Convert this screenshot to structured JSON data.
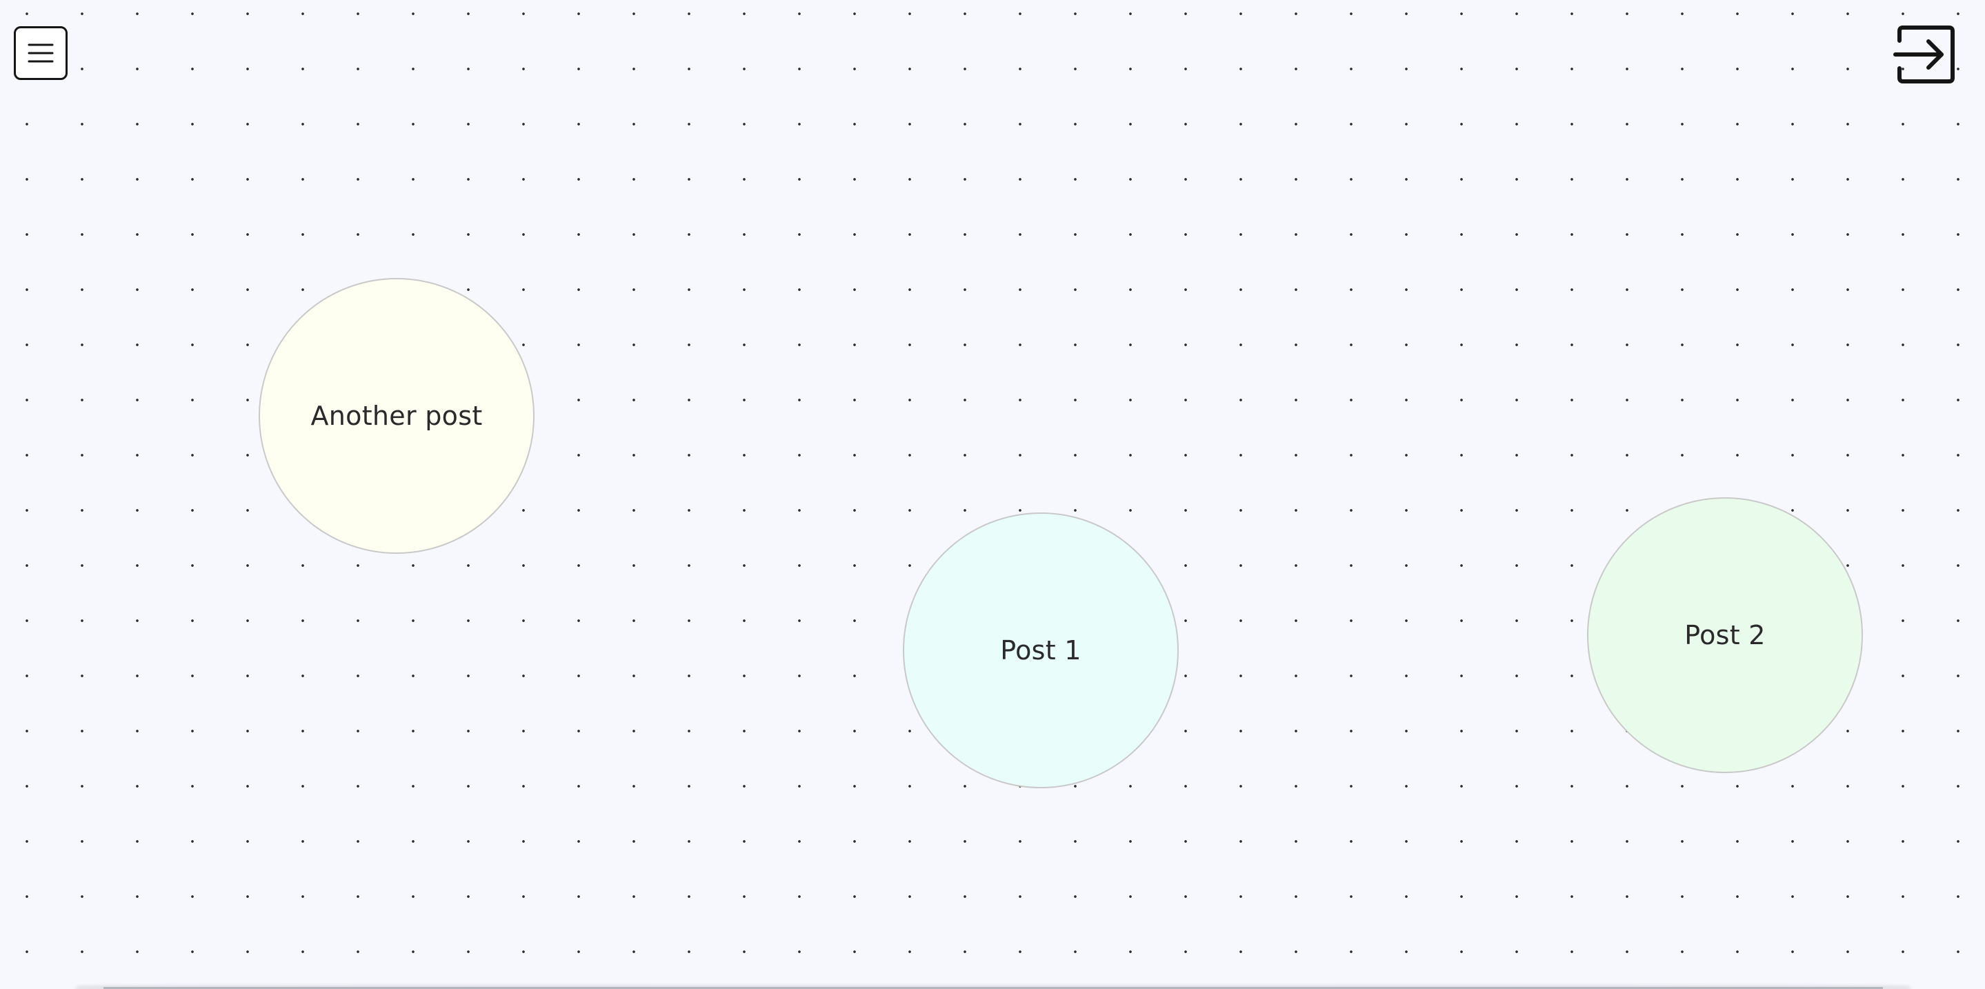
{
  "toolbar": {
    "menu_icon": "menu-icon",
    "login_icon": "login-icon"
  },
  "posts": [
    {
      "label": "Another post",
      "color": "#fefff0"
    },
    {
      "label": "Post 1",
      "color": "#e9fdfb"
    },
    {
      "label": "Post 2",
      "color": "#e9fcec"
    }
  ],
  "canvas": {
    "background_color": "#f7f8fd",
    "dot_color": "#2a2a2a"
  }
}
